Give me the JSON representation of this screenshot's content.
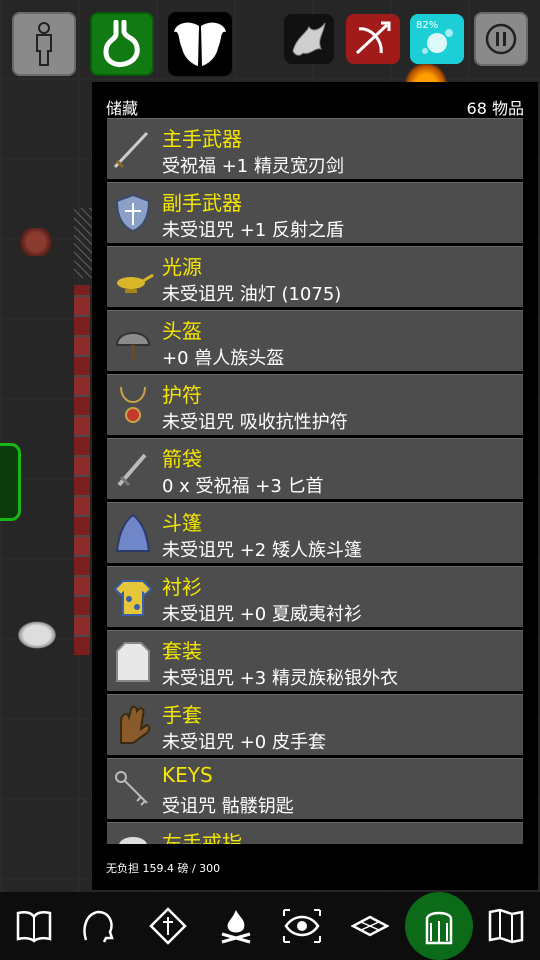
{
  "top_bar": {
    "status_percent": "82%"
  },
  "inventory": {
    "title": "储藏",
    "count": "68 物品",
    "footer": "无负担 159.4 磅 / 300",
    "items": [
      {
        "slot": "主手武器",
        "desc": "受祝福 +1 精灵宽刃剑",
        "icon": "sword-icon"
      },
      {
        "slot": "副手武器",
        "desc": "未受诅咒 +1 反射之盾",
        "icon": "shield-icon"
      },
      {
        "slot": "光源",
        "desc": "未受诅咒 油灯 (1075)",
        "icon": "lamp-icon"
      },
      {
        "slot": "头盔",
        "desc": "+0 兽人族头盔",
        "icon": "helmet-icon"
      },
      {
        "slot": "护符",
        "desc": "未受诅咒 吸收抗性护符",
        "icon": "amulet-icon"
      },
      {
        "slot": "箭袋",
        "desc": "0 x 受祝福 +3 匕首",
        "icon": "dagger-icon"
      },
      {
        "slot": "斗篷",
        "desc": "未受诅咒 +2 矮人族斗篷",
        "icon": "cloak-icon"
      },
      {
        "slot": "衬衫",
        "desc": "未受诅咒 +0 夏威夷衬衫",
        "icon": "shirt-icon"
      },
      {
        "slot": "套装",
        "desc": "未受诅咒 +3 精灵族秘银外衣",
        "icon": "mithril-coat-icon"
      },
      {
        "slot": "手套",
        "desc": "未受诅咒 +0 皮手套",
        "icon": "gloves-icon"
      },
      {
        "slot": "KEYS",
        "desc": "受诅咒 骷髅钥匙",
        "icon": "key-icon"
      },
      {
        "slot": "左手戒指",
        "desc": "",
        "icon": "ring-icon"
      }
    ]
  },
  "colors": {
    "slot_label": "#f5e600",
    "row_bg": "#4d4d4d",
    "active_tab": "#0b6b19"
  }
}
